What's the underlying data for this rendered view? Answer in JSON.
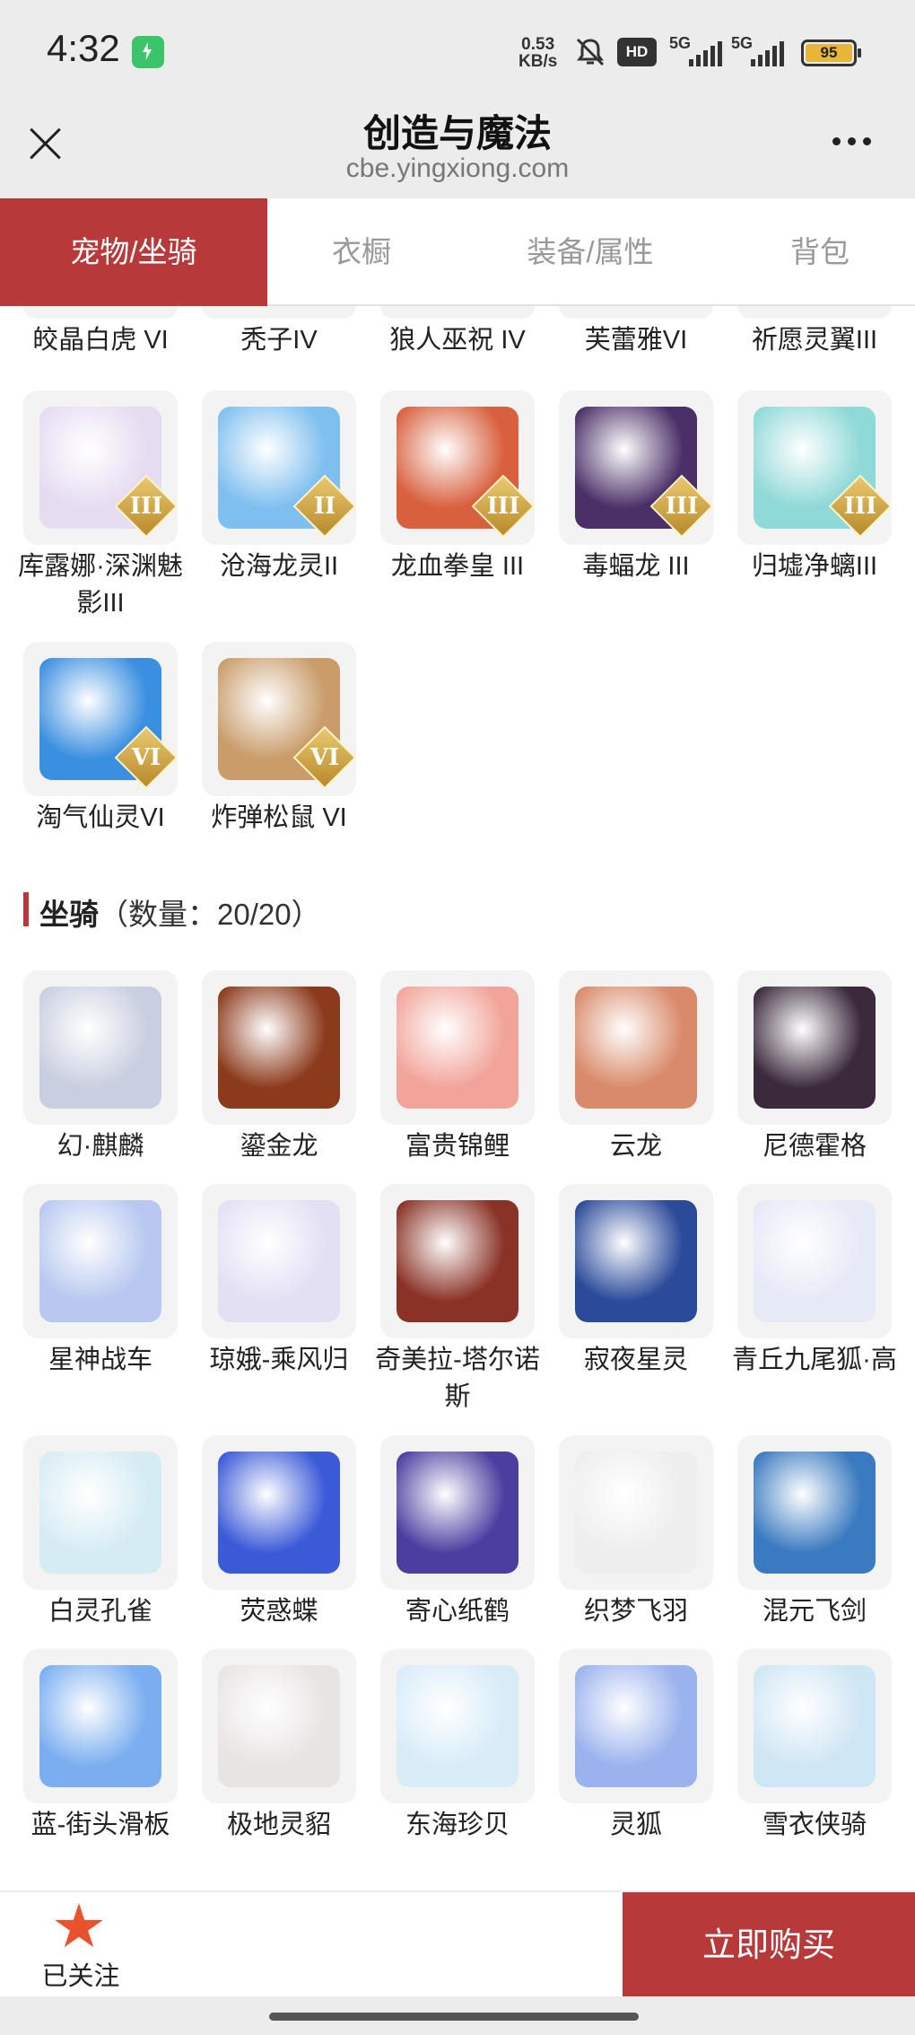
{
  "status_bar": {
    "time": "4:32",
    "net_speed_value": "0.53",
    "net_speed_unit": "KB/s",
    "hd_label": "HD",
    "signal_1": "5G",
    "signal_2": "5G",
    "battery": "95"
  },
  "header": {
    "title": "创造与魔法",
    "url": "cbe.yingxiong.com"
  },
  "tabs": [
    {
      "label": "宠物/坐骑",
      "active": true
    },
    {
      "label": "衣橱",
      "active": false
    },
    {
      "label": "装备/属性",
      "active": false
    },
    {
      "label": "背包",
      "active": false
    }
  ],
  "pets": {
    "partial_row": [
      "皎晶白虎 VI",
      "秃子IV",
      "狼人巫祝 IV",
      "芙蕾雅VI",
      "祈愿灵翼III"
    ],
    "items": [
      {
        "name": "库露娜·深渊魅影III",
        "badge": "III",
        "color": "#e6dcf2"
      },
      {
        "name": "沧海龙灵II",
        "badge": "II",
        "color": "#7fbff0"
      },
      {
        "name": "龙血拳皇 III",
        "badge": "III",
        "color": "#d8603e"
      },
      {
        "name": "毒蝠龙 III",
        "badge": "III",
        "color": "#4b3068"
      },
      {
        "name": "归墟净螭III",
        "badge": "III",
        "color": "#8fd9d8"
      },
      {
        "name": "淘气仙灵VI",
        "badge": "VI",
        "color": "#3a8fe0"
      },
      {
        "name": "炸弹松鼠 VI",
        "badge": "VI",
        "color": "#c99c6a"
      }
    ]
  },
  "mounts": {
    "title": "坐骑",
    "count": "（数量：20/20）",
    "items": [
      {
        "name": "幻·麒麟",
        "color": "#c9cfe0"
      },
      {
        "name": "鎏金龙",
        "color": "#8c3a1c"
      },
      {
        "name": "富贵锦鲤",
        "color": "#f2a49a"
      },
      {
        "name": "云龙",
        "color": "#d98a6a"
      },
      {
        "name": "尼德霍格",
        "color": "#3b2a3c"
      },
      {
        "name": "星神战车",
        "color": "#b8c8f0"
      },
      {
        "name": "琼娥-乘风归",
        "color": "#e4e0f4"
      },
      {
        "name": "奇美拉-塔尔诺斯",
        "color": "#8a3226"
      },
      {
        "name": "寂夜星灵",
        "color": "#2a4a9a"
      },
      {
        "name": "青丘九尾狐·高",
        "color": "#e6e9f6"
      },
      {
        "name": "白灵孔雀",
        "color": "#d6ecf4"
      },
      {
        "name": "荧惑蝶",
        "color": "#3b5ad8"
      },
      {
        "name": "寄心纸鹤",
        "color": "#4a3ea0"
      },
      {
        "name": "织梦飞羽",
        "color": "#eeeeee"
      },
      {
        "name": "混元飞剑",
        "color": "#3a7ac0"
      },
      {
        "name": "蓝-街头滑板",
        "color": "#7aaef0"
      },
      {
        "name": "极地灵貂",
        "color": "#e8e4e4"
      },
      {
        "name": "东海珍贝",
        "color": "#d8ecf8"
      },
      {
        "name": "灵狐",
        "color": "#9ab2ee"
      },
      {
        "name": "雪衣侠骑",
        "color": "#cfe6f4"
      }
    ]
  },
  "bottom": {
    "follow_label": "已关注",
    "buy_label": "立即购买"
  }
}
